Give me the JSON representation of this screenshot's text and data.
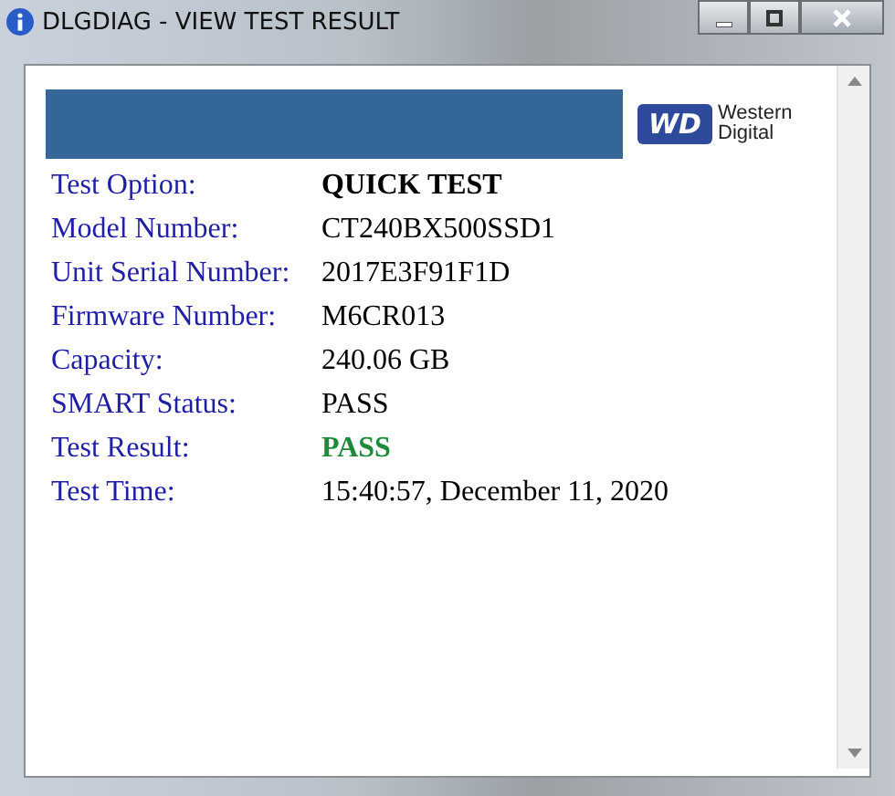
{
  "window": {
    "title": "DLGDIAG - VIEW TEST RESULT"
  },
  "logo": {
    "mark": "WD",
    "name_lines": [
      "Western",
      "Digital"
    ]
  },
  "results": [
    {
      "label": "Test Option:",
      "value": "QUICK TEST",
      "kind": "bold"
    },
    {
      "label": "Model Number:",
      "value": "CT240BX500SSD1",
      "kind": "plain"
    },
    {
      "label": "Unit Serial Number:",
      "value": "2017E3F91F1D",
      "kind": "plain"
    },
    {
      "label": "Firmware Number:",
      "value": "M6CR013",
      "kind": "plain"
    },
    {
      "label": "Capacity:",
      "value": "240.06 GB",
      "kind": "plain"
    },
    {
      "label": "SMART Status:",
      "value": "PASS",
      "kind": "plain"
    },
    {
      "label": "Test Result:",
      "value": "PASS",
      "kind": "pass"
    },
    {
      "label": "Test Time:",
      "value": "15:40:57, December 11, 2020",
      "kind": "plain"
    }
  ]
}
